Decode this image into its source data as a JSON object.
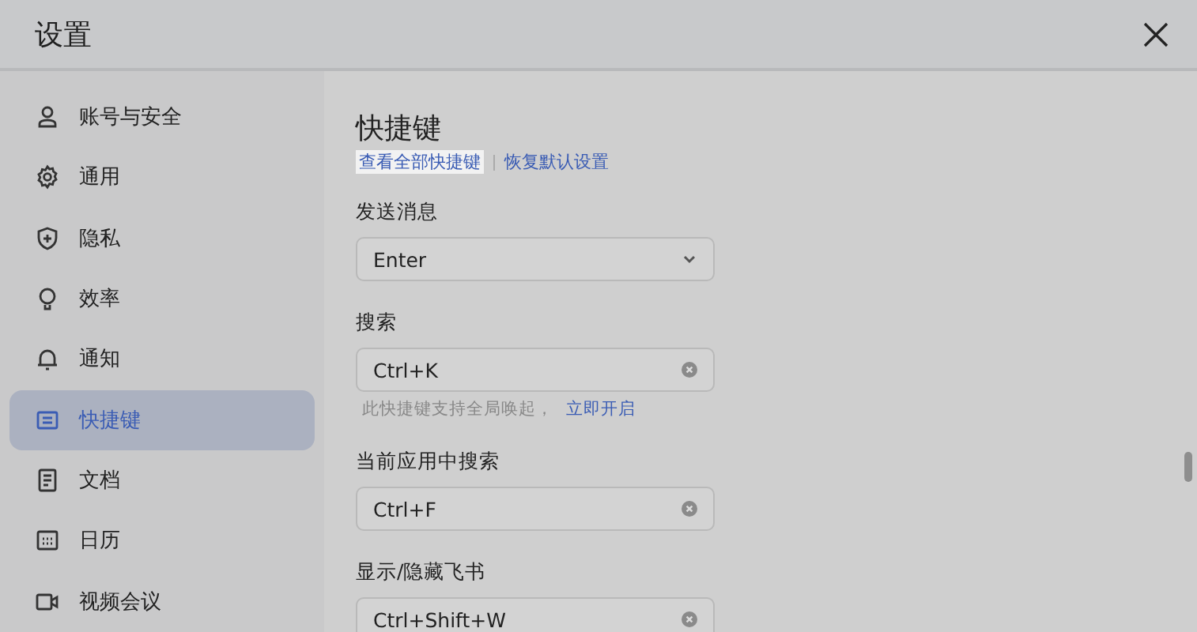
{
  "window": {
    "title": "设置"
  },
  "sidebar": {
    "items": [
      {
        "label": "账号与安全",
        "selected": false
      },
      {
        "label": "通用",
        "selected": false
      },
      {
        "label": "隐私",
        "selected": false
      },
      {
        "label": "效率",
        "selected": false
      },
      {
        "label": "通知",
        "selected": false
      },
      {
        "label": "快捷键",
        "selected": true
      },
      {
        "label": "文档",
        "selected": false
      },
      {
        "label": "日历",
        "selected": false
      },
      {
        "label": "视频会议",
        "selected": false
      }
    ]
  },
  "content": {
    "heading": "快捷键",
    "links": [
      "查看全部快捷键",
      "恢复默认设置"
    ],
    "settings": [
      {
        "kind": "select",
        "label": "发送消息",
        "value": "Enter"
      },
      {
        "kind": "shortcut",
        "label": "搜索",
        "value": "Ctrl+K",
        "hint": "此快捷键支持全局唤起，",
        "hint_link": "立即开启"
      },
      {
        "kind": "shortcut",
        "label": "当前应用中搜索",
        "value": "Ctrl+F"
      },
      {
        "kind": "shortcut",
        "label": "显示/隐藏飞书",
        "value": "Ctrl+Shift+W"
      }
    ]
  }
}
